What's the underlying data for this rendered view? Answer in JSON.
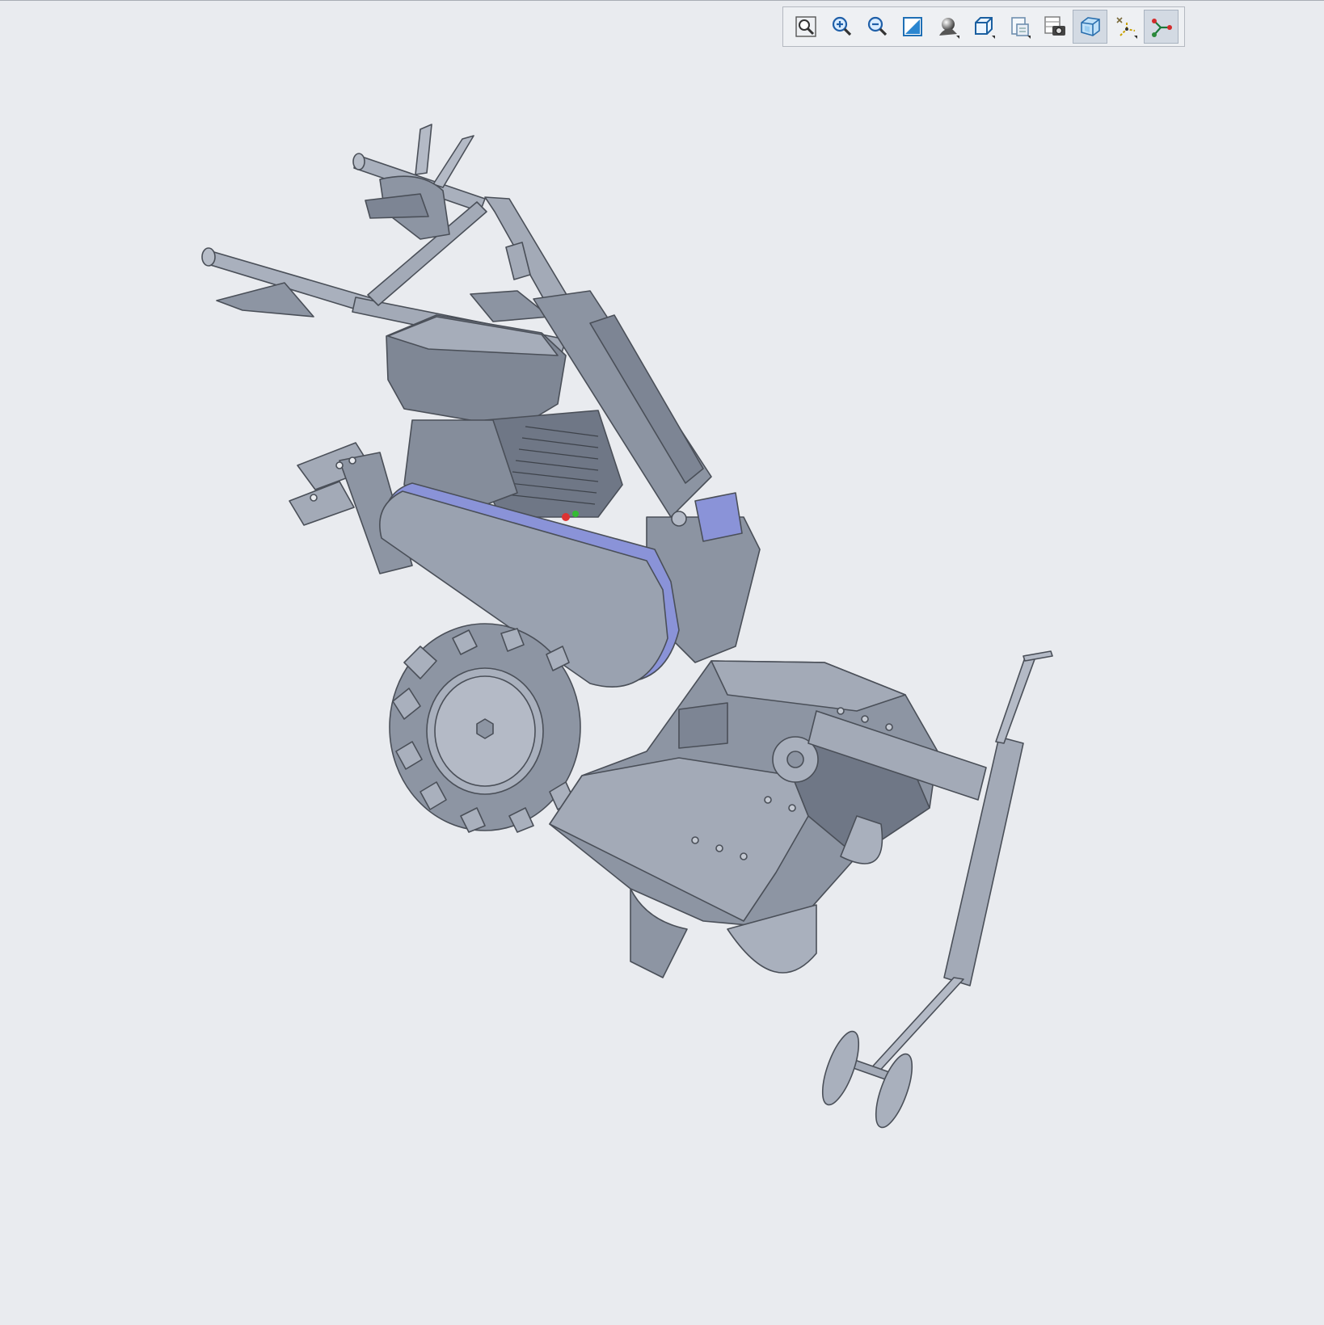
{
  "window": {
    "background": "#e9ebef"
  },
  "toolbar": {
    "buttons": [
      {
        "name": "zoom-fit-button",
        "icon": "zoom-fit-icon",
        "active": false,
        "dropdown": false
      },
      {
        "name": "zoom-in-button",
        "icon": "zoom-in-icon",
        "active": false,
        "dropdown": false
      },
      {
        "name": "zoom-out-button",
        "icon": "zoom-out-icon",
        "active": false,
        "dropdown": false
      },
      {
        "name": "repaint-button",
        "icon": "repaint-icon",
        "active": false,
        "dropdown": false
      },
      {
        "name": "display-style-button",
        "icon": "shaded-sphere-icon",
        "active": false,
        "dropdown": true
      },
      {
        "name": "saved-views-button",
        "icon": "cube-view-icon",
        "active": false,
        "dropdown": true
      },
      {
        "name": "view-manager-button",
        "icon": "view-manager-icon",
        "active": false,
        "dropdown": true
      },
      {
        "name": "appearance-button",
        "icon": "camera-icon",
        "active": false,
        "dropdown": false
      },
      {
        "name": "perspective-button",
        "icon": "perspective-cube-icon",
        "active": true,
        "dropdown": false
      },
      {
        "name": "datum-display-button",
        "icon": "datum-axes-icon",
        "active": false,
        "dropdown": true
      },
      {
        "name": "annotation-display-button",
        "icon": "spin-center-icon",
        "active": true,
        "dropdown": false
      }
    ]
  },
  "model": {
    "name": "walk-behind-tiller-assembly",
    "body_color": "#9aa2b0",
    "edge_color": "#4a4f58",
    "highlight_color": "#8a93d8"
  }
}
